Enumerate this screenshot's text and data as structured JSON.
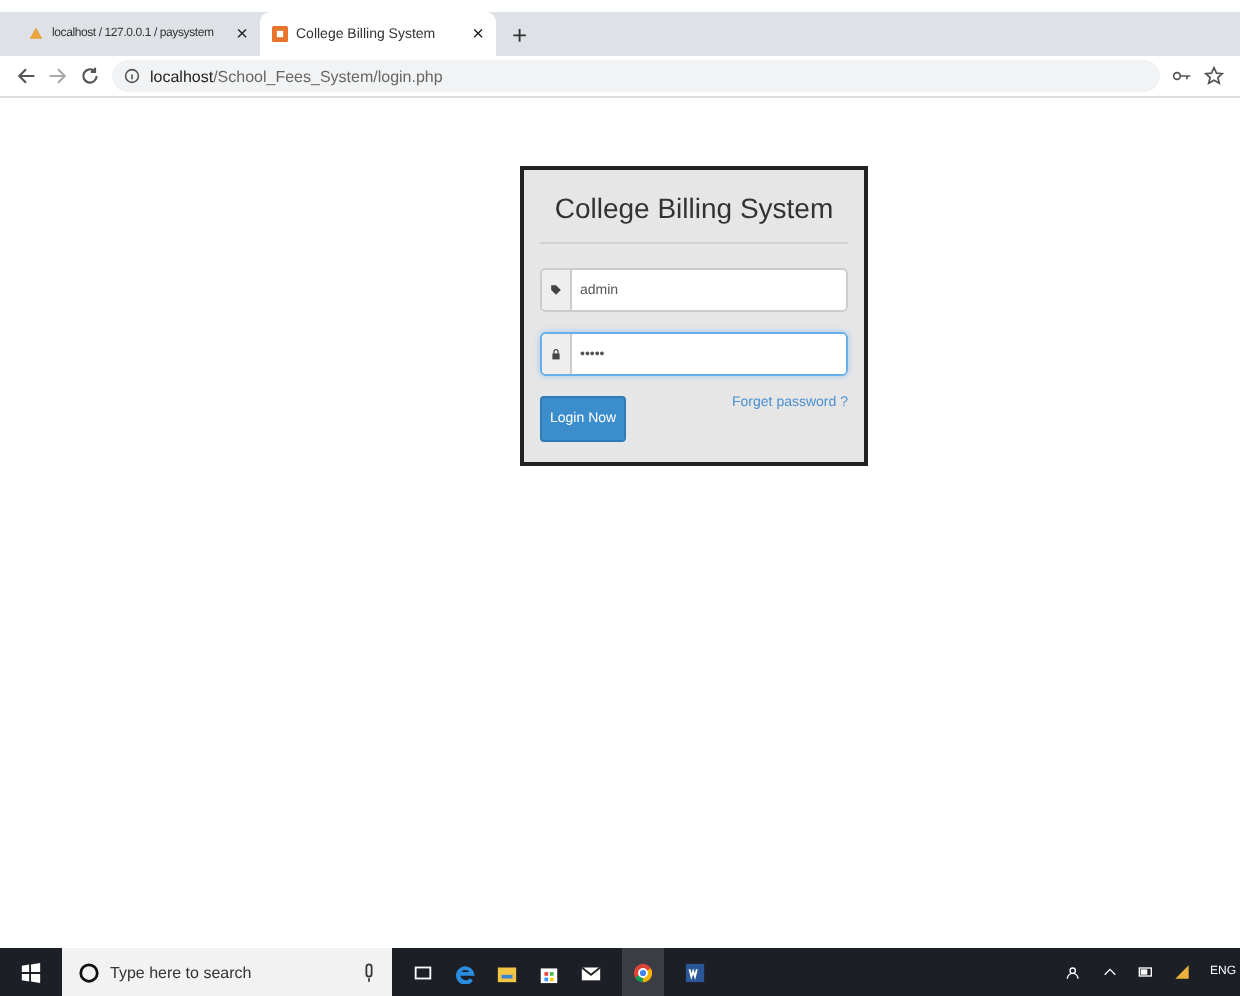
{
  "tabs": [
    {
      "title": "localhost / 127.0.0.1 / paysystem",
      "selected": false,
      "close": "×"
    },
    {
      "title": "College Billing System",
      "selected": true,
      "close": "×"
    }
  ],
  "new_tab": "+",
  "address_bar": {
    "host": "localhost",
    "path": "/School_Fees_System/login.php"
  },
  "login": {
    "title": "College Billing System",
    "username": "admin",
    "password": "•••••",
    "button": "Login Now",
    "forgot_link": "Forget password ?"
  },
  "taskbar": {
    "search_placeholder": "Type here to search",
    "language": "ENG"
  }
}
